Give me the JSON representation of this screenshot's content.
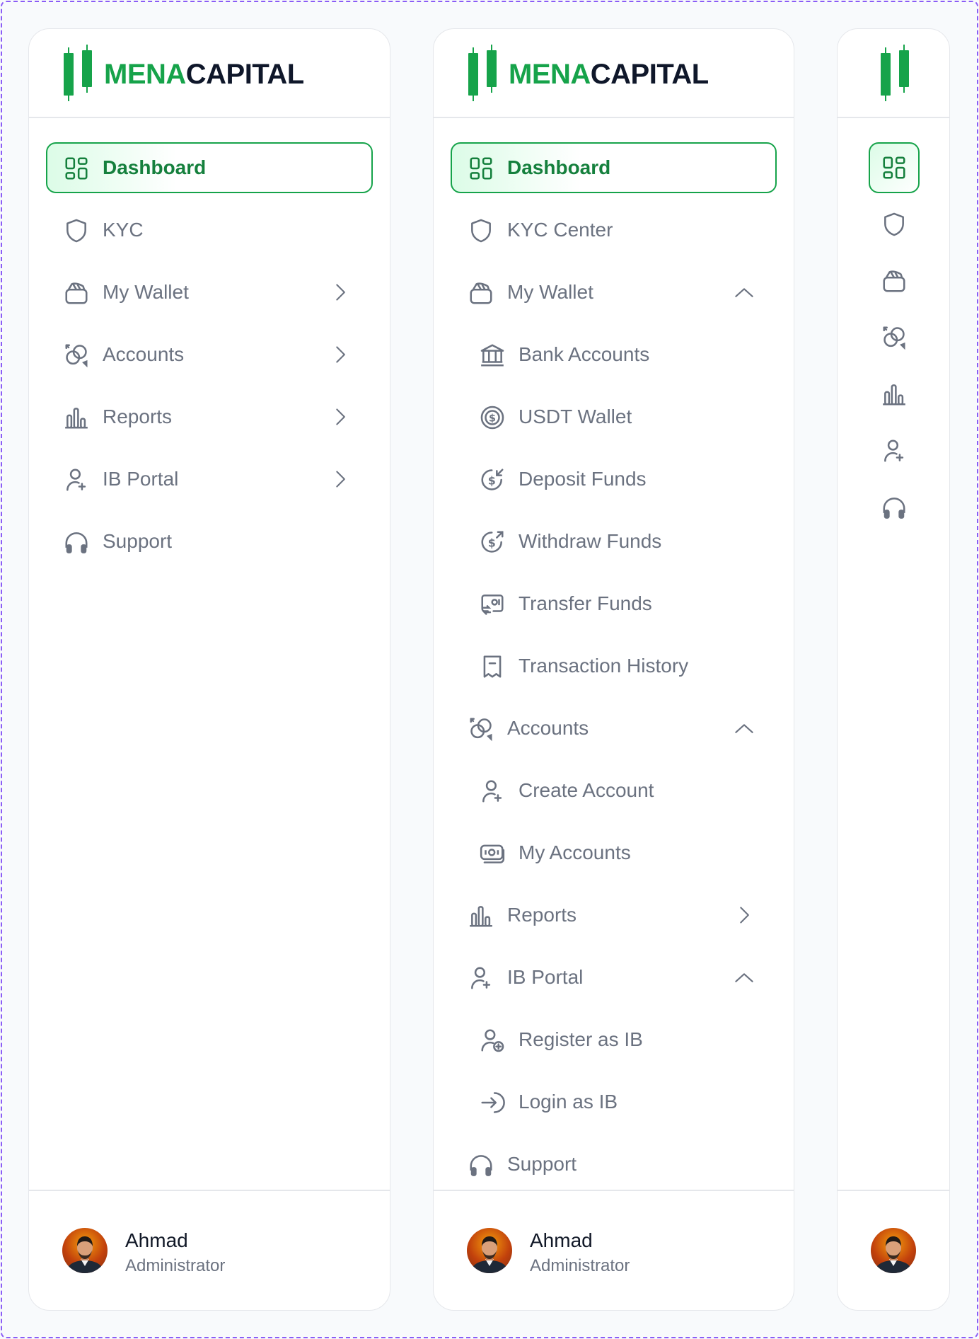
{
  "brand": {
    "part1": "MENA",
    "part2": "CAPITAL"
  },
  "colors": {
    "accent": "#16a34a",
    "text_muted": "#6b7280",
    "border": "#e5e7eb",
    "frame": "#8b5cf6"
  },
  "sidebar_expanded_collapsed": {
    "items": [
      {
        "label": "Dashboard",
        "icon": "dashboard-icon",
        "active": true
      },
      {
        "label": "KYC",
        "icon": "shield-icon"
      },
      {
        "label": "My Wallet",
        "icon": "wallet-icon",
        "chevron": "right"
      },
      {
        "label": "Accounts",
        "icon": "accounts-icon",
        "chevron": "right"
      },
      {
        "label": "Reports",
        "icon": "bar-chart-icon",
        "chevron": "right"
      },
      {
        "label": "IB Portal",
        "icon": "user-plus-icon",
        "chevron": "right"
      },
      {
        "label": "Support",
        "icon": "headphones-icon"
      }
    ]
  },
  "sidebar_expanded_open": {
    "items": [
      {
        "label": "Dashboard",
        "icon": "dashboard-icon",
        "active": true
      },
      {
        "label": "KYC Center",
        "icon": "shield-icon"
      },
      {
        "label": "My Wallet",
        "icon": "wallet-icon",
        "chevron": "up"
      },
      {
        "label": "Bank Accounts",
        "icon": "bank-icon",
        "sub": true
      },
      {
        "label": "USDT Wallet",
        "icon": "coin-icon",
        "sub": true
      },
      {
        "label": "Deposit Funds",
        "icon": "deposit-icon",
        "sub": true
      },
      {
        "label": "Withdraw Funds",
        "icon": "withdraw-icon",
        "sub": true
      },
      {
        "label": "Transfer Funds",
        "icon": "transfer-icon",
        "sub": true
      },
      {
        "label": "Transaction History",
        "icon": "receipt-icon",
        "sub": true
      },
      {
        "label": "Accounts",
        "icon": "accounts-icon",
        "chevron": "up"
      },
      {
        "label": "Create Account",
        "icon": "user-plus-icon",
        "sub": true
      },
      {
        "label": "My Accounts",
        "icon": "money-icon",
        "sub": true
      },
      {
        "label": "Reports",
        "icon": "bar-chart-icon",
        "chevron": "right"
      },
      {
        "label": "IB Portal",
        "icon": "user-plus-icon",
        "chevron": "up"
      },
      {
        "label": "Register as IB",
        "icon": "user-add-circle-icon",
        "sub": true
      },
      {
        "label": "Login as IB",
        "icon": "login-icon",
        "sub": true
      },
      {
        "label": "Support",
        "icon": "headphones-icon"
      }
    ]
  },
  "sidebar_mini": {
    "items": [
      {
        "icon": "dashboard-icon",
        "active": true
      },
      {
        "icon": "shield-icon"
      },
      {
        "icon": "wallet-icon"
      },
      {
        "icon": "accounts-icon"
      },
      {
        "icon": "bar-chart-icon"
      },
      {
        "icon": "user-plus-icon"
      },
      {
        "icon": "headphones-icon"
      }
    ]
  },
  "user": {
    "name": "Ahmad",
    "role": "Administrator"
  }
}
